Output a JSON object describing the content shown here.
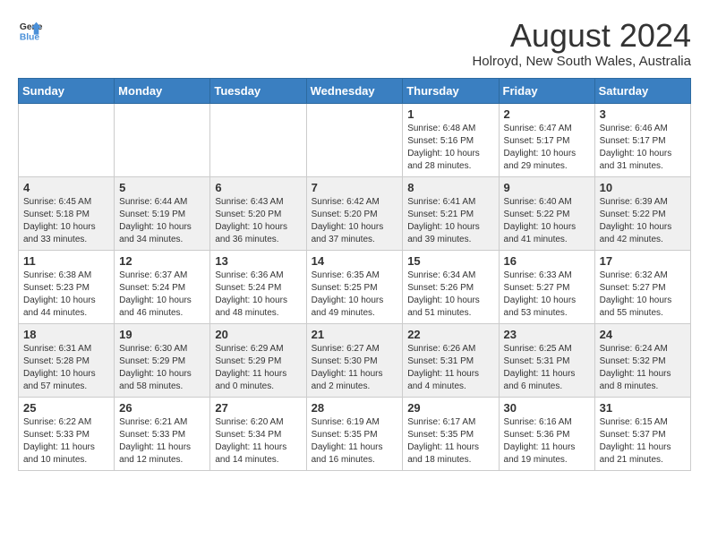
{
  "header": {
    "logo_line1": "General",
    "logo_line2": "Blue",
    "month_year": "August 2024",
    "location": "Holroyd, New South Wales, Australia"
  },
  "days_of_week": [
    "Sunday",
    "Monday",
    "Tuesday",
    "Wednesday",
    "Thursday",
    "Friday",
    "Saturday"
  ],
  "weeks": [
    [
      {
        "day": "",
        "content": ""
      },
      {
        "day": "",
        "content": ""
      },
      {
        "day": "",
        "content": ""
      },
      {
        "day": "",
        "content": ""
      },
      {
        "day": "1",
        "content": "Sunrise: 6:48 AM\nSunset: 5:16 PM\nDaylight: 10 hours\nand 28 minutes."
      },
      {
        "day": "2",
        "content": "Sunrise: 6:47 AM\nSunset: 5:17 PM\nDaylight: 10 hours\nand 29 minutes."
      },
      {
        "day": "3",
        "content": "Sunrise: 6:46 AM\nSunset: 5:17 PM\nDaylight: 10 hours\nand 31 minutes."
      }
    ],
    [
      {
        "day": "4",
        "content": "Sunrise: 6:45 AM\nSunset: 5:18 PM\nDaylight: 10 hours\nand 33 minutes."
      },
      {
        "day": "5",
        "content": "Sunrise: 6:44 AM\nSunset: 5:19 PM\nDaylight: 10 hours\nand 34 minutes."
      },
      {
        "day": "6",
        "content": "Sunrise: 6:43 AM\nSunset: 5:20 PM\nDaylight: 10 hours\nand 36 minutes."
      },
      {
        "day": "7",
        "content": "Sunrise: 6:42 AM\nSunset: 5:20 PM\nDaylight: 10 hours\nand 37 minutes."
      },
      {
        "day": "8",
        "content": "Sunrise: 6:41 AM\nSunset: 5:21 PM\nDaylight: 10 hours\nand 39 minutes."
      },
      {
        "day": "9",
        "content": "Sunrise: 6:40 AM\nSunset: 5:22 PM\nDaylight: 10 hours\nand 41 minutes."
      },
      {
        "day": "10",
        "content": "Sunrise: 6:39 AM\nSunset: 5:22 PM\nDaylight: 10 hours\nand 42 minutes."
      }
    ],
    [
      {
        "day": "11",
        "content": "Sunrise: 6:38 AM\nSunset: 5:23 PM\nDaylight: 10 hours\nand 44 minutes."
      },
      {
        "day": "12",
        "content": "Sunrise: 6:37 AM\nSunset: 5:24 PM\nDaylight: 10 hours\nand 46 minutes."
      },
      {
        "day": "13",
        "content": "Sunrise: 6:36 AM\nSunset: 5:24 PM\nDaylight: 10 hours\nand 48 minutes."
      },
      {
        "day": "14",
        "content": "Sunrise: 6:35 AM\nSunset: 5:25 PM\nDaylight: 10 hours\nand 49 minutes."
      },
      {
        "day": "15",
        "content": "Sunrise: 6:34 AM\nSunset: 5:26 PM\nDaylight: 10 hours\nand 51 minutes."
      },
      {
        "day": "16",
        "content": "Sunrise: 6:33 AM\nSunset: 5:27 PM\nDaylight: 10 hours\nand 53 minutes."
      },
      {
        "day": "17",
        "content": "Sunrise: 6:32 AM\nSunset: 5:27 PM\nDaylight: 10 hours\nand 55 minutes."
      }
    ],
    [
      {
        "day": "18",
        "content": "Sunrise: 6:31 AM\nSunset: 5:28 PM\nDaylight: 10 hours\nand 57 minutes."
      },
      {
        "day": "19",
        "content": "Sunrise: 6:30 AM\nSunset: 5:29 PM\nDaylight: 10 hours\nand 58 minutes."
      },
      {
        "day": "20",
        "content": "Sunrise: 6:29 AM\nSunset: 5:29 PM\nDaylight: 11 hours\nand 0 minutes."
      },
      {
        "day": "21",
        "content": "Sunrise: 6:27 AM\nSunset: 5:30 PM\nDaylight: 11 hours\nand 2 minutes."
      },
      {
        "day": "22",
        "content": "Sunrise: 6:26 AM\nSunset: 5:31 PM\nDaylight: 11 hours\nand 4 minutes."
      },
      {
        "day": "23",
        "content": "Sunrise: 6:25 AM\nSunset: 5:31 PM\nDaylight: 11 hours\nand 6 minutes."
      },
      {
        "day": "24",
        "content": "Sunrise: 6:24 AM\nSunset: 5:32 PM\nDaylight: 11 hours\nand 8 minutes."
      }
    ],
    [
      {
        "day": "25",
        "content": "Sunrise: 6:22 AM\nSunset: 5:33 PM\nDaylight: 11 hours\nand 10 minutes."
      },
      {
        "day": "26",
        "content": "Sunrise: 6:21 AM\nSunset: 5:33 PM\nDaylight: 11 hours\nand 12 minutes."
      },
      {
        "day": "27",
        "content": "Sunrise: 6:20 AM\nSunset: 5:34 PM\nDaylight: 11 hours\nand 14 minutes."
      },
      {
        "day": "28",
        "content": "Sunrise: 6:19 AM\nSunset: 5:35 PM\nDaylight: 11 hours\nand 16 minutes."
      },
      {
        "day": "29",
        "content": "Sunrise: 6:17 AM\nSunset: 5:35 PM\nDaylight: 11 hours\nand 18 minutes."
      },
      {
        "day": "30",
        "content": "Sunrise: 6:16 AM\nSunset: 5:36 PM\nDaylight: 11 hours\nand 19 minutes."
      },
      {
        "day": "31",
        "content": "Sunrise: 6:15 AM\nSunset: 5:37 PM\nDaylight: 11 hours\nand 21 minutes."
      }
    ]
  ]
}
